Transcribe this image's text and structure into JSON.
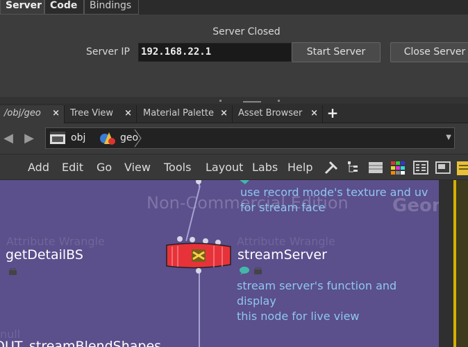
{
  "top_tabs": [
    "Server",
    "Code",
    "Bindings"
  ],
  "server": {
    "status": "Server Closed",
    "ip_label": "Server IP",
    "ip_value": "192.168.22.1",
    "start_button": "Start Server",
    "close_button": "Close Server"
  },
  "pane_tabs": [
    {
      "label": "/obj/geo",
      "close": "×"
    },
    {
      "label": "Tree View",
      "close": "×"
    },
    {
      "label": "Material Palette",
      "close": "×"
    },
    {
      "label": "Asset Browser",
      "close": "×"
    }
  ],
  "add_tab": "+",
  "path": {
    "crumbs": [
      "obj",
      "geo"
    ],
    "back_icon": "back-arrow-icon",
    "forward_icon": "forward-arrow-icon"
  },
  "menu": [
    "Add",
    "Edit",
    "Go",
    "View",
    "Tools",
    "Layout",
    "Labs",
    "Help"
  ],
  "network": {
    "watermark": "Non-Commercial Edition",
    "context_label": "Geomet",
    "top_comment": [
      "use record mode's texture and uv",
      "for stream face"
    ],
    "nodes": [
      {
        "type": "Attribute Wrangle",
        "name": "getDetailBS"
      },
      {
        "type": "Attribute Wrangle",
        "name": "streamServer"
      },
      {
        "type": "null",
        "name": "OUT_streamBlendShapes"
      }
    ],
    "stream_comment": [
      "stream server's function and display",
      "this node for live view"
    ]
  },
  "colors": {
    "network_bg": "#5b4f8c",
    "node_red": "#e8323a",
    "comment_blue": "#8fc7ee"
  }
}
